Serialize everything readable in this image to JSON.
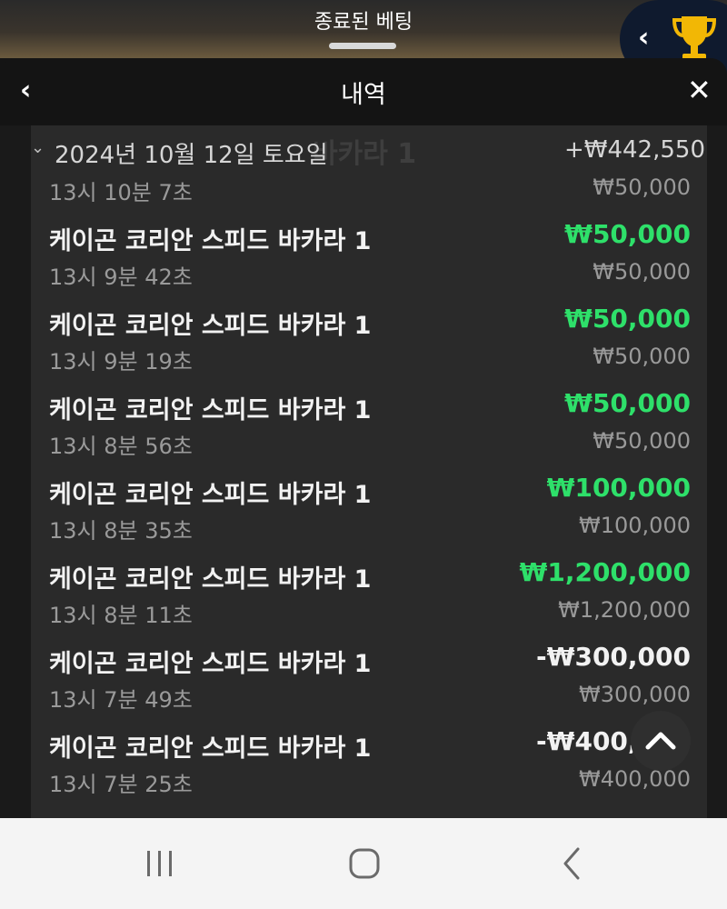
{
  "top_title": "종료된 베팅",
  "header": {
    "title": "내역"
  },
  "date_group": {
    "date": "2024년 10월 12일 토요일",
    "total": "+₩442,550"
  },
  "ghost_text": "바카라 1",
  "partial_row": {
    "time": "13시 10분 7초",
    "stake": "₩50,000"
  },
  "bets": [
    {
      "game": "케이곤 코리안 스피드 바카라 1",
      "time": "13시 9분 42초",
      "result": "₩50,000",
      "stake": "₩50,000",
      "status": "win"
    },
    {
      "game": "케이곤 코리안 스피드 바카라 1",
      "time": "13시 9분 19초",
      "result": "₩50,000",
      "stake": "₩50,000",
      "status": "win"
    },
    {
      "game": "케이곤 코리안 스피드 바카라 1",
      "time": "13시 8분 56초",
      "result": "₩50,000",
      "stake": "₩50,000",
      "status": "win"
    },
    {
      "game": "케이곤 코리안 스피드 바카라 1",
      "time": "13시 8분 35초",
      "result": "₩100,000",
      "stake": "₩100,000",
      "status": "win"
    },
    {
      "game": "케이곤 코리안 스피드 바카라 1",
      "time": "13시 8분 11초",
      "result": "₩1,200,000",
      "stake": "₩1,200,000",
      "status": "win"
    },
    {
      "game": "케이곤 코리안 스피드 바카라 1",
      "time": "13시 7분 49초",
      "result": "-₩300,000",
      "stake": "₩300,000",
      "status": "loss"
    },
    {
      "game": "케이곤 코리안 스피드 바카라 1",
      "time": "13시 7분 25초",
      "result": "-₩400,000",
      "stake": "₩400,000",
      "status": "loss"
    }
  ],
  "colors": {
    "win": "#2ee06a",
    "loss": "#f2f2f2",
    "panel": "#2a2a2a",
    "trophy": "#f2b705"
  },
  "icons": {
    "back": "chevron-left-icon",
    "close": "close-icon",
    "trophy": "trophy-icon",
    "scroll_top": "chevron-up-icon",
    "nav_recents": "recents-icon",
    "nav_home": "home-icon",
    "nav_back": "back-icon"
  }
}
